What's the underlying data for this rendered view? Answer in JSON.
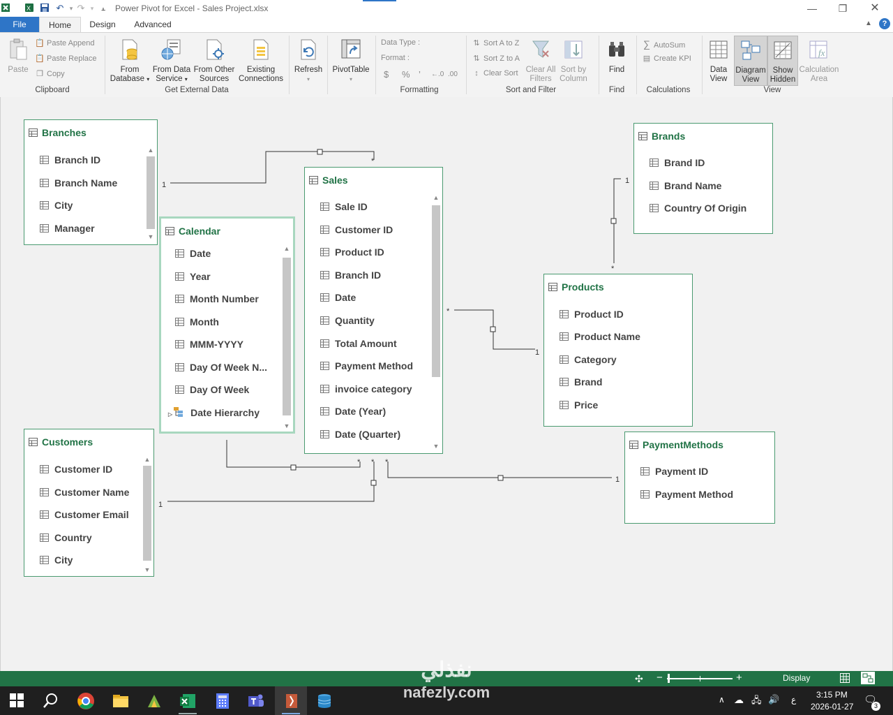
{
  "window": {
    "title": "Power Pivot for Excel - Sales Project.xlsx"
  },
  "tabs": [
    {
      "label": "File"
    },
    {
      "label": "Home"
    },
    {
      "label": "Design"
    },
    {
      "label": "Advanced"
    }
  ],
  "ribbon": {
    "clipboard": {
      "paste": "Paste",
      "paste_append": "Paste Append",
      "paste_replace": "Paste Replace",
      "copy": "Copy",
      "group": "Clipboard"
    },
    "external": {
      "from_database_1": "From",
      "from_database_2": "Database",
      "from_data_service_1": "From Data",
      "from_data_service_2": "Service",
      "from_other_1": "From Other",
      "from_other_2": "Sources",
      "existing_1": "Existing",
      "existing_2": "Connections",
      "group": "Get External Data"
    },
    "refresh": "Refresh",
    "pivottable": "PivotTable",
    "formatting": {
      "data_type": "Data Type :",
      "format": "Format :",
      "currency": "$",
      "percent": "%",
      "comma": "’",
      "inc_decimal": "←.0",
      "dec_decimal": ".00",
      "group": "Formatting"
    },
    "sort": {
      "a_to_z": "Sort A to Z",
      "z_to_a": "Sort Z to A",
      "clear_sort": "Clear Sort",
      "clear_filters_1": "Clear All",
      "clear_filters_2": "Filters",
      "sort_by_col_1": "Sort by",
      "sort_by_col_2": "Column",
      "group": "Sort and Filter"
    },
    "find": {
      "label": "Find",
      "group": "Find"
    },
    "calculations": {
      "autosum": "AutoSum",
      "create_kpi": "Create KPI",
      "group": "Calculations"
    },
    "view": {
      "data_view_1": "Data",
      "data_view_2": "View",
      "diagram_view_1": "Diagram",
      "diagram_view_2": "View",
      "show_hidden_1": "Show",
      "show_hidden_2": "Hidden",
      "calc_area_1": "Calculation",
      "calc_area_2": "Area",
      "group": "View"
    }
  },
  "tables": {
    "branches": {
      "name": "Branches",
      "fields": [
        "Branch ID",
        "Branch Name",
        "City",
        "Manager"
      ]
    },
    "calendar": {
      "name": "Calendar",
      "fields": [
        "Date",
        "Year",
        "Month Number",
        "Month",
        "MMM-YYYY",
        "Day Of Week N...",
        "Day Of Week",
        "Date Hierarchy"
      ]
    },
    "sales": {
      "name": "Sales",
      "fields": [
        "Sale ID",
        "Customer ID",
        "Product ID",
        "Branch ID",
        "Date",
        "Quantity",
        "Total Amount",
        "Payment Method",
        "invoice category",
        "Date (Year)",
        "Date (Quarter)"
      ]
    },
    "brands": {
      "name": "Brands",
      "fields": [
        "Brand ID",
        "Brand Name",
        "Country Of Origin"
      ]
    },
    "products": {
      "name": "Products",
      "fields": [
        "Product ID",
        "Product Name",
        "Category",
        "Brand",
        "Price"
      ]
    },
    "customers": {
      "name": "Customers",
      "fields": [
        "Customer ID",
        "Customer Name",
        "Customer Email",
        "Country",
        "City"
      ]
    },
    "payment_methods": {
      "name": "PaymentMethods",
      "fields": [
        "Payment ID",
        "Payment Method"
      ]
    }
  },
  "relationships": {
    "one": "1",
    "many": "*"
  },
  "statusbar": {
    "display": "Display"
  },
  "taskbar": {
    "time": "3:15 PM",
    "date": "2026-01-27",
    "lang": "ع",
    "notifications": "3"
  },
  "watermark": {
    "arabic": "نفذلي",
    "latin": "nafezly.com"
  },
  "colors": {
    "accent_green": "#217346",
    "file_tab": "#2e75c7",
    "table_border": "#4a9a70"
  }
}
